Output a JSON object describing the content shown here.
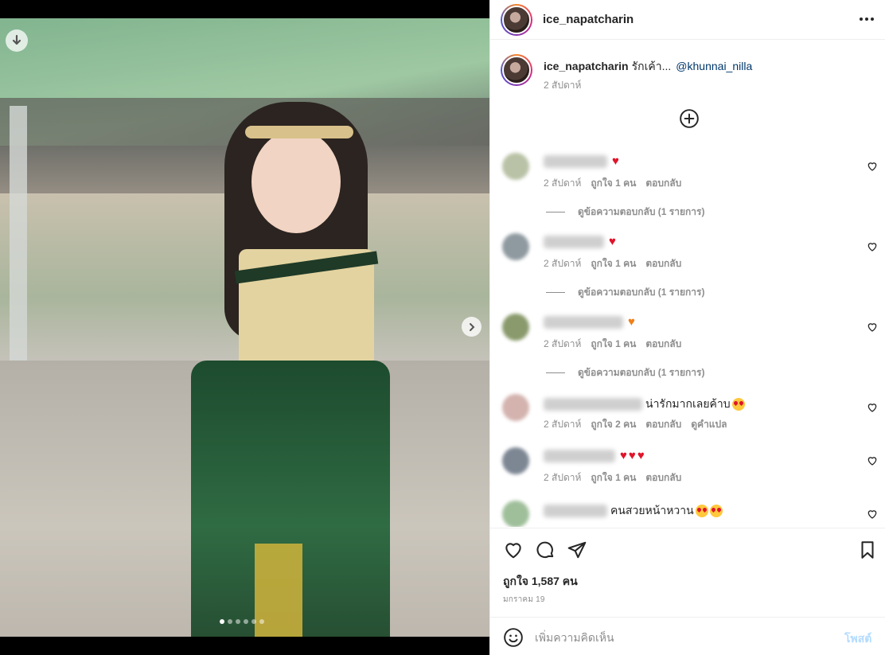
{
  "post": {
    "username": "ice_napatcharin",
    "caption_text": "รักเค้า...",
    "caption_mention": "@khunnai_nilla",
    "caption_time": "2 สัปดาห์",
    "likes_text": "ถูกใจ 1,587 คน",
    "date_text": "มกราคม 19",
    "carousel_count": 6,
    "carousel_active": 0
  },
  "comments": [
    {
      "text": "",
      "emoji": "heart-red",
      "emoji_count": 1,
      "time": "2 สัปดาห์",
      "likes": "ถูกใจ 1 คน",
      "reply": "ตอบกลับ",
      "translate": "",
      "replies_text": "ดูข้อความตอบกลับ (1 รายการ)",
      "avatar_color": "#b9c2a6"
    },
    {
      "text": "",
      "emoji": "heart-red",
      "emoji_count": 1,
      "time": "2 สัปดาห์",
      "likes": "ถูกใจ 1 คน",
      "reply": "ตอบกลับ",
      "translate": "",
      "replies_text": "ดูข้อความตอบกลับ (1 รายการ)",
      "avatar_color": "#8f9aa0"
    },
    {
      "text": "",
      "emoji": "heart-orange",
      "emoji_count": 1,
      "time": "2 สัปดาห์",
      "likes": "ถูกใจ 1 คน",
      "reply": "ตอบกลับ",
      "translate": "",
      "replies_text": "ดูข้อความตอบกลับ (1 รายการ)",
      "avatar_color": "#8a9a6c"
    },
    {
      "text": "น่ารักมากเลยค้าบ",
      "emoji": "face",
      "emoji_count": 1,
      "time": "2 สัปดาห์",
      "likes": "ถูกใจ 2 คน",
      "reply": "ตอบกลับ",
      "translate": "ดูคำแปล",
      "replies_text": "",
      "avatar_color": "#d4b3ae"
    },
    {
      "text": "",
      "emoji": "heart-red",
      "emoji_count": 3,
      "time": "2 สัปดาห์",
      "likes": "ถูกใจ 1 คน",
      "reply": "ตอบกลับ",
      "translate": "",
      "replies_text": "",
      "avatar_color": "#7d8794"
    },
    {
      "text": "คนสวยหน้าหวาน",
      "emoji": "face",
      "emoji_count": 2,
      "time": "",
      "likes": "",
      "reply": "",
      "translate": "",
      "replies_text": "",
      "avatar_color": "#9fbf9a"
    }
  ],
  "comment_input": {
    "placeholder": "เพิ่มความคิดเห็น",
    "post_label": "โพสต์"
  },
  "colors": {
    "link": "#00376b",
    "secondary_text": "#8e8e8e",
    "post_button_disabled": "#b3dbff",
    "heart_red": "#e0142b"
  }
}
